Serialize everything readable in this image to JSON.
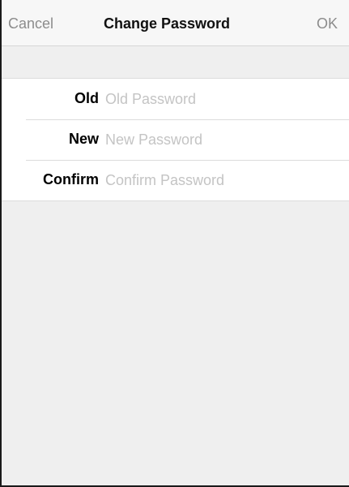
{
  "navbar": {
    "cancel_label": "Cancel",
    "title": "Change Password",
    "ok_label": "OK"
  },
  "form": {
    "rows": [
      {
        "label": "Old",
        "placeholder": "Old Password",
        "value": ""
      },
      {
        "label": "New",
        "placeholder": "New Password",
        "value": ""
      },
      {
        "label": "Confirm",
        "placeholder": "Confirm Password",
        "value": ""
      }
    ]
  },
  "colors": {
    "background": "#efefef",
    "navbar_background": "#f7f7f7",
    "nav_button_text": "#8c8c8c",
    "placeholder_text": "#c4c4c4",
    "separator": "#dcdcdc"
  }
}
